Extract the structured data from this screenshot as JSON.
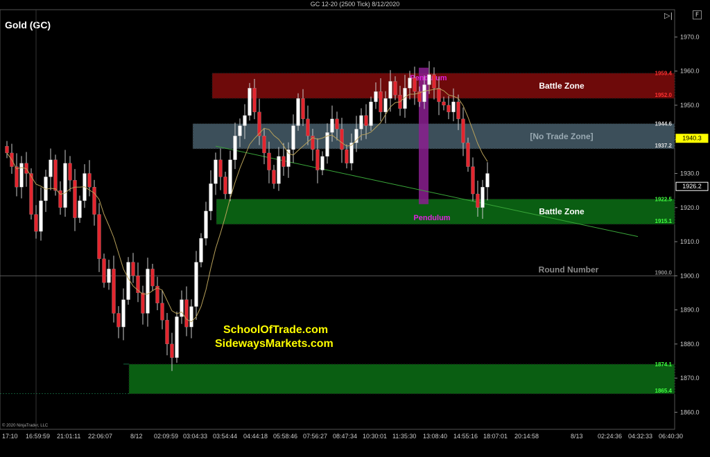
{
  "window": {
    "title": "GC 12-20 (2500 Tick)  8/12/2020"
  },
  "toolbar": {
    "collapse_icon": "collapse-right-icon",
    "button_f": "F"
  },
  "instrument": "Gold (GC)",
  "copyright": "© 2020 NinjaTrader, LLC",
  "watermark": {
    "line1": "SchoolOfTrade.com",
    "line2": "SidewaysMarkets.com"
  },
  "colors": {
    "up": "#ffffff",
    "down": "#e3262f",
    "battle_red": "#6e0a0a",
    "battle_green": "#0a5e12",
    "no_trade": "#3c4f5a",
    "pendulum": "#8a1f8f",
    "pendulum_label": "#e020e0",
    "trendline": "#3aa83a",
    "ma": "#b8a15a",
    "price_label_red": "#ff3030",
    "price_label_green": "#40ff40"
  },
  "chart_data": {
    "type": "candlestick",
    "ylim": [
      1855,
      1978
    ],
    "y_ticks": [
      1860,
      1870,
      1880,
      1890,
      1900,
      1910,
      1920,
      1930,
      1940,
      1950,
      1960,
      1970
    ],
    "y_tick_labels": [
      "1860.0",
      "1870.0",
      "1880.0",
      "1890.0",
      "1900.0",
      "1910.0",
      "1920.0",
      "1930.0",
      "1940.0",
      "1950.0",
      "1960.0",
      "1970.0"
    ],
    "x_labels": [
      "17:10",
      "16:59:59",
      "21:01:11",
      "22:06:07",
      "8/12",
      "02:09:59",
      "03:04:33",
      "03:54:44",
      "04:44:18",
      "05:58:46",
      "07:56:27",
      "08:47:34",
      "10:30:01",
      "11:35:30",
      "13:08:40",
      "14:55:16",
      "18:07:01",
      "20:14:58",
      "8/13",
      "02:24:36",
      "04:32:33",
      "06:40:30"
    ],
    "bar_count": 100,
    "closes": [
      1936,
      1932,
      1926,
      1933,
      1930,
      1918,
      1913,
      1922,
      1929,
      1934,
      1925,
      1920,
      1933,
      1928,
      1917,
      1922,
      1930,
      1926,
      1918,
      1905,
      1898,
      1902,
      1889,
      1885,
      1893,
      1904,
      1900,
      1895,
      1889,
      1902,
      1897,
      1892,
      1887,
      1880,
      1876,
      1888,
      1893,
      1885,
      1891,
      1904,
      1911,
      1919,
      1927,
      1934,
      1929,
      1924,
      1934,
      1941,
      1944,
      1947,
      1955,
      1948,
      1941,
      1936,
      1931,
      1927,
      1935,
      1932,
      1937,
      1944,
      1952,
      1946,
      1941,
      1937,
      1931,
      1935,
      1942,
      1946,
      1943,
      1937,
      1933,
      1939,
      1943,
      1947,
      1944,
      1951,
      1954,
      1948,
      1952,
      1957,
      1953,
      1949,
      1955,
      1958,
      1954,
      1951,
      1956,
      1959,
      1955,
      1951,
      1950,
      1948,
      1951,
      1946,
      1939,
      1932,
      1924,
      1920,
      1926,
      1930
    ],
    "zones": [
      {
        "label": "Battle Zone",
        "top": 1959.4,
        "bottom": 1952.0,
        "top_label": "1959.4",
        "bottom_label": "1952.0",
        "kind": "battle_red"
      },
      {
        "label": "[No Trade Zone]",
        "top": 1944.6,
        "bottom": 1937.2,
        "top_label": "1944.6",
        "bottom_label": "1937.2",
        "kind": "no_trade"
      },
      {
        "label": "Battle Zone",
        "top": 1922.5,
        "bottom": 1915.1,
        "top_label": "1922.5",
        "bottom_label": "1915.1",
        "kind": "battle_green"
      },
      {
        "label": "",
        "top": 1874.1,
        "bottom": 1865.4,
        "top_label": "1874.1",
        "bottom_label": "1865.4",
        "kind": "battle_green"
      }
    ],
    "round_number": {
      "label": "Round Number",
      "value": 1900.0,
      "value_label": "1900.0"
    },
    "pendulum": {
      "label": "Pendulum",
      "top": 1961,
      "bottom": 1921
    },
    "trendline": {
      "start_bar": 43,
      "start_price": 1938,
      "end_bar": 130,
      "end_price": 1911.5
    },
    "markers": [
      {
        "label": "1940.3",
        "value": 1940.3,
        "style": "yellow"
      },
      {
        "label": "1926.2",
        "value": 1926.2,
        "style": "white"
      }
    ]
  }
}
